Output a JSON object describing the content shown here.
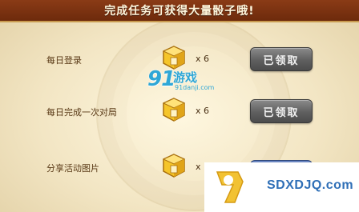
{
  "banner": {
    "title": "完成任务可获得大量骰子哦!"
  },
  "tasks": [
    {
      "label": "每日登录",
      "reward": "x 6",
      "button": "已领取"
    },
    {
      "label": "每日完成一次对局",
      "reward": "x 6",
      "button": "已领取"
    },
    {
      "label": "分享活动图片",
      "reward": "x"
    }
  ],
  "watermark": {
    "number": "91",
    "name": "游戏",
    "domain": "91danji.com"
  },
  "corner_overlay": {
    "text": "SDXDJQ.com"
  },
  "colors": {
    "banner": "#7a3310",
    "button_done": "#6a6a6a",
    "button_active": "#5a76b4",
    "watermark": "#2fa7d6",
    "overlay_text": "#2f6fb7",
    "chest": "#e8b41c"
  }
}
